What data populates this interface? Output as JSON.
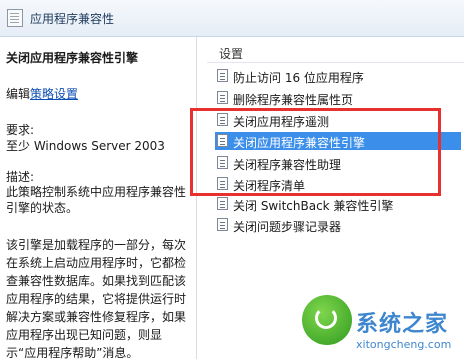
{
  "window": {
    "title": "应用程序兼容性"
  },
  "description": {
    "heading": "关闭应用程序兼容性引擎",
    "edit_prefix": "编辑",
    "edit_link": "策略设置",
    "requirements_label": "要求:",
    "requirements_value": "至少 Windows Server 2003",
    "desc_label": "描述:",
    "desc_text": " 此策略控制系统中应用程序兼容性引擎的状态。",
    "desc_text2": "该引擎是加载程序的一部分，每次在系统上启动应用程序时，它都检查兼容性数据库。如果找到匹配该应用程序的结果，它将提供运行时解决方案或兼容性修复程序，如果应用程序出现已知问题，则显示“应用程序帮助”消息。"
  },
  "list": {
    "column_header": "设置",
    "items": [
      {
        "label": "防止访问 16 位应用程序"
      },
      {
        "label": "删除程序兼容性属性页"
      },
      {
        "label": "关闭应用程序遥测"
      },
      {
        "label": "关闭应用程序兼容性引擎"
      },
      {
        "label": "关闭程序兼容性助理"
      },
      {
        "label": "关闭程序清单"
      },
      {
        "label": "关闭 SwitchBack 兼容性引擎"
      },
      {
        "label": "关闭问题步骤记录器"
      }
    ],
    "selected_index": 3
  },
  "watermark": {
    "text": "系统之家",
    "url": "xitongcheng.com"
  },
  "colors": {
    "selection": "#3b8ee9",
    "highlight_box": "#e8312f",
    "link": "#0b4db3"
  }
}
